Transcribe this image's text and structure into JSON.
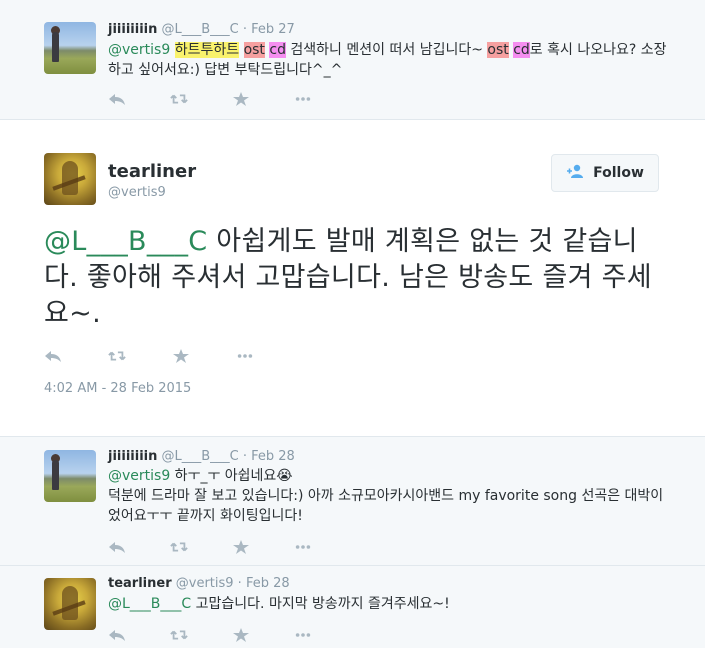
{
  "replies_top": {
    "name": "jiiiiiiiin",
    "meta": "@L___B___C · Feb 27",
    "mention": "@vertis9",
    "seg1": "하트",
    "seg2": "투",
    "seg3": "하트",
    "seg4": "ost",
    "seg5": "cd",
    "text_a": " 검색하니 멘션이 떠서 남깁니다~ ",
    "seg6": "ost",
    "seg7": "cd",
    "text_b": "로 혹시 나오나요? 소장하고 싶어서요:) 답변 부탁드립니다^_^"
  },
  "main_tweet": {
    "name": "tearliner",
    "handle": "@vertis9",
    "follow_label": "Follow",
    "mention": "@L___B___C",
    "text": " 아쉽게도 발매 계획은 없는 것 같습니다. 좋아해 주셔서 고맙습니다. 남은 방송도 즐겨 주세요~.",
    "timestamp": "4:02 AM - 28 Feb 2015"
  },
  "reply2": {
    "name": "jiiiiiiiin",
    "meta": "@L___B___C · Feb 28",
    "mention": "@vertis9",
    "line1": " 하ㅜ_ㅜ 아쉽네요😭",
    "line2": "덕분에 드라마 잘 보고 있습니다:) 아까 소규모아카시아밴드 my favorite song 선곡은 대박이었어요ㅜㅜ 끝까지 화이팅입니다!"
  },
  "reply3": {
    "name": "tearliner",
    "meta": "@vertis9 · Feb 28",
    "mention": "@L___B___C",
    "text": " 고맙습니다. 마지막 방송까지 즐겨주세요~!"
  },
  "icons": {
    "reply": "reply-icon",
    "retweet": "retweet-icon",
    "favorite": "star-icon",
    "more": "more-icon",
    "follow": "add-user-icon"
  },
  "colors": {
    "mention": "#2a8a5a",
    "meta": "#8899a6",
    "action": "#aab8c2",
    "highlight_yellow": "#f9f26c",
    "highlight_red": "#f6a0a0",
    "highlight_magenta": "#f58ef0"
  }
}
